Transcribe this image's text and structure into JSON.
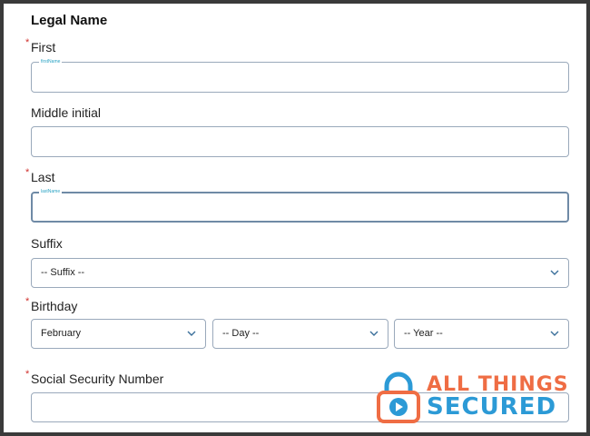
{
  "form": {
    "section_title": "Legal Name",
    "first": {
      "label": "First",
      "float_label": "firstName",
      "value": ""
    },
    "middle": {
      "label": "Middle initial",
      "value": ""
    },
    "last": {
      "label": "Last",
      "float_label": "lastName",
      "value": ""
    },
    "suffix": {
      "label": "Suffix",
      "selected": "-- Suffix --"
    },
    "birthday": {
      "label": "Birthday",
      "month_selected": "February",
      "day_selected": "-- Day --",
      "year_selected": "-- Year --"
    },
    "ssn": {
      "label": "Social Security Number",
      "value": ""
    },
    "required_marker": "*"
  },
  "watermark": {
    "line1": "ALL THINGS",
    "line2": "SECURED",
    "icon": "padlock-play-icon",
    "colors": {
      "orange": "#ef6d44",
      "blue": "#2c9ad6"
    }
  },
  "colors": {
    "field_border": "#9aa9bb",
    "focus_border": "#6f8aa6",
    "float_label": "#2aa3c4",
    "required": "#d0312d",
    "chevron": "#3a6f9a"
  }
}
